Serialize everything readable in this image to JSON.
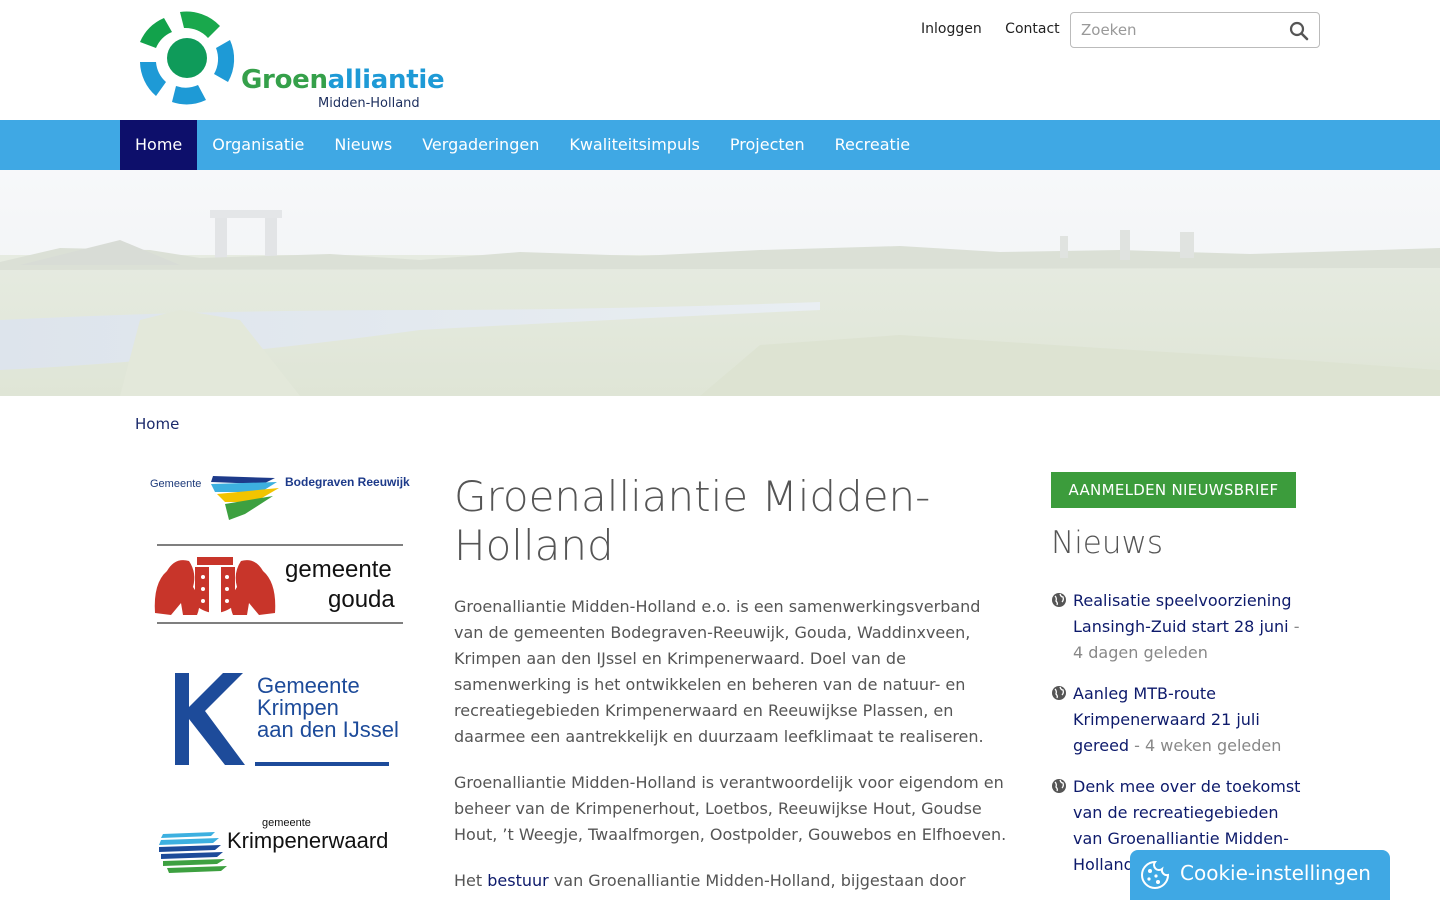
{
  "header": {
    "logo_name_part1": "Groen",
    "logo_name_part2": "alliantie",
    "logo_subtitle": "Midden-Holland",
    "links": [
      "Inloggen",
      "Contact"
    ],
    "search_placeholder": "Zoeken"
  },
  "nav": {
    "items": [
      "Home",
      "Organisatie",
      "Nieuws",
      "Vergaderingen",
      "Kwaliteitsimpuls",
      "Projecten",
      "Recreatie"
    ],
    "active": "Home"
  },
  "breadcrumb": "Home",
  "municipalities": {
    "bodegraven": {
      "prefix": "Gemeente",
      "name": "Bodegraven Reeuwijk"
    },
    "gouda": {
      "line1": "gemeente",
      "line2": "gouda"
    },
    "krimpen": {
      "letter": "K",
      "line1": "Gemeente",
      "line2": "Krimpen",
      "line3": "aan den IJssel"
    },
    "krimpenerwaard": {
      "prefix": "gemeente",
      "name": "Krimpenerwaard"
    }
  },
  "main": {
    "title": "Groenalliantie Midden-Holland",
    "paragraph1": "Groenalliantie Midden-Holland e.o. is een samenwerkingsverband van de gemeenten Bodegraven-Reeuwijk, Gouda, Waddinxveen, Krimpen aan den IJssel en Krimpenerwaard. Doel van de samenwerking is het ontwikkelen en beheren van de natuur- en recreatiegebieden Krimpenerwaard en Reeuwijkse Plassen, en daarmee een aantrekkelijk en duurzaam leefklimaat te realiseren.",
    "paragraph2": "Groenalliantie Midden-Holland is verantwoordelijk voor eigendom en beheer van de Krimpenerhout, Loetbos, Reeuwijkse Hout, Goudse Hout, ’t Weegje, Twaalfmorgen, Oostpolder, Gouwebos en Elfhoeven.",
    "paragraph3_prefix": "Het ",
    "paragraph3_link": "bestuur",
    "paragraph3_suffix": " van Groenalliantie Midden-Holland, bijgestaan door"
  },
  "sidebar": {
    "newsletter_button": "AANMELDEN NIEUWSBRIEF",
    "news_title": "Nieuws",
    "news": [
      {
        "title": "Realisatie speelvoorziening Lansingh-Zuid start 28 juni",
        "age": " - 4 dagen geleden"
      },
      {
        "title": "Aanleg MTB-route Krimpenerwaard 21 juli gereed",
        "age": " - 4 weken geleden"
      },
      {
        "title": "Denk mee over de toekomst van de recreatiegebieden van Groenalliantie Midden-Holland",
        "age": ""
      }
    ]
  },
  "cookie": {
    "label": "Cookie-instellingen"
  },
  "colors": {
    "nav_bg": "#3fa8e4",
    "nav_active": "#0d0f6b",
    "brand_green": "#35a04a",
    "brand_blue": "#1e9ad6",
    "link": "#0d1a6b",
    "button_green": "#3c9c3c"
  }
}
